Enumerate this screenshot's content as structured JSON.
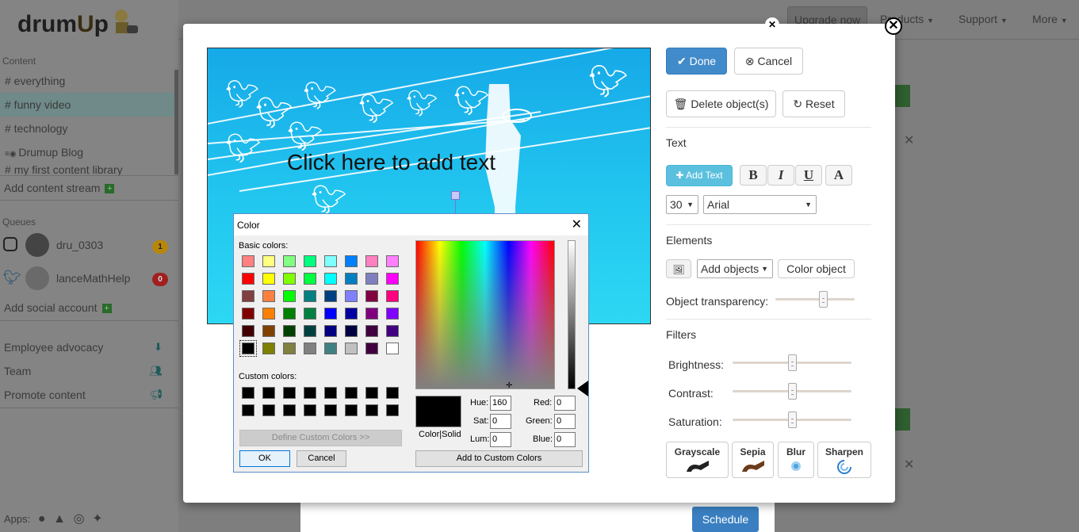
{
  "app": {
    "logo_text_a": "drum",
    "logo_text_b": "U",
    "logo_text_c": "p"
  },
  "sidebar": {
    "content_heading": "Content",
    "streams": [
      {
        "label": "# everything"
      },
      {
        "label": "# funny video"
      },
      {
        "label": "# technology"
      },
      {
        "label": "Drumup Blog"
      },
      {
        "label": "my first content library"
      }
    ],
    "add_stream": "Add content stream",
    "queues_heading": "Queues",
    "accounts": [
      {
        "name": "dru_0303",
        "badge": "1",
        "badge_color": "#b8860b"
      },
      {
        "name": "lanceMathHelp",
        "badge": "0",
        "badge_color": "#a02020"
      }
    ],
    "add_social": "Add social account",
    "links": [
      {
        "label": "Employee advocacy"
      },
      {
        "label": "Team"
      },
      {
        "label": "Promote content"
      }
    ],
    "apps_label": "Apps:"
  },
  "topbar": {
    "upgrade": "Upgrade now",
    "products": "Products",
    "support": "Support",
    "more": "More"
  },
  "background": {
    "schedule": "Schedule"
  },
  "editor": {
    "canvas_text": "Click here to add text",
    "done": "Done",
    "cancel": "Cancel",
    "delete_objects": "Delete object(s)",
    "reset": "Reset",
    "text_heading": "Text",
    "add_text": "Add Text",
    "bold": "B",
    "italic": "I",
    "underline": "U",
    "color_a": "A",
    "font_size": "30",
    "font_family": "Arial",
    "elements_heading": "Elements",
    "add_objects": "Add objects",
    "color_object": "Color object",
    "object_transparency": "Object transparency:",
    "object_transparency_value": 0.6,
    "filters_heading": "Filters",
    "brightness": "Brightness:",
    "brightness_value": 0.5,
    "contrast": "Contrast:",
    "contrast_value": 0.5,
    "saturation": "Saturation:",
    "saturation_value": 0.5,
    "filters": [
      {
        "label": "Grayscale"
      },
      {
        "label": "Sepia"
      },
      {
        "label": "Blur"
      },
      {
        "label": "Sharpen"
      }
    ]
  },
  "color_dialog": {
    "title": "Color",
    "basic_colors_label": "Basic colors:",
    "basic_colors": [
      "#ff8080",
      "#ffff80",
      "#80ff80",
      "#00ff80",
      "#80ffff",
      "#0080ff",
      "#ff80c0",
      "#ff80ff",
      "#ff0000",
      "#ffff00",
      "#80ff00",
      "#00ff40",
      "#00ffff",
      "#0080c0",
      "#8080c0",
      "#ff00ff",
      "#804040",
      "#ff8040",
      "#00ff00",
      "#008080",
      "#004080",
      "#8080ff",
      "#800040",
      "#ff0080",
      "#800000",
      "#ff8000",
      "#008000",
      "#008040",
      "#0000ff",
      "#0000a0",
      "#800080",
      "#8000ff",
      "#400000",
      "#804000",
      "#004000",
      "#004040",
      "#000080",
      "#000040",
      "#400040",
      "#400080",
      "#000000",
      "#808000",
      "#808040",
      "#808080",
      "#408080",
      "#c0c0c0",
      "#400040",
      "#ffffff"
    ],
    "custom_colors_label": "Custom colors:",
    "custom_colors": [
      "#000000",
      "#000000",
      "#000000",
      "#000000",
      "#000000",
      "#000000",
      "#000000",
      "#000000",
      "#000000",
      "#000000",
      "#000000",
      "#000000",
      "#000000",
      "#000000",
      "#000000",
      "#000000"
    ],
    "define_custom": "Define Custom Colors >>",
    "ok": "OK",
    "cancel": "Cancel",
    "color_solid": "Color|Solid",
    "hue_label": "Hue:",
    "hue": "160",
    "sat_label": "Sat:",
    "sat": "0",
    "lum_label": "Lum:",
    "lum": "0",
    "red_label": "Red:",
    "red": "0",
    "green_label": "Green:",
    "green": "0",
    "blue_label": "Blue:",
    "blue": "0",
    "add_custom": "Add to Custom Colors"
  }
}
